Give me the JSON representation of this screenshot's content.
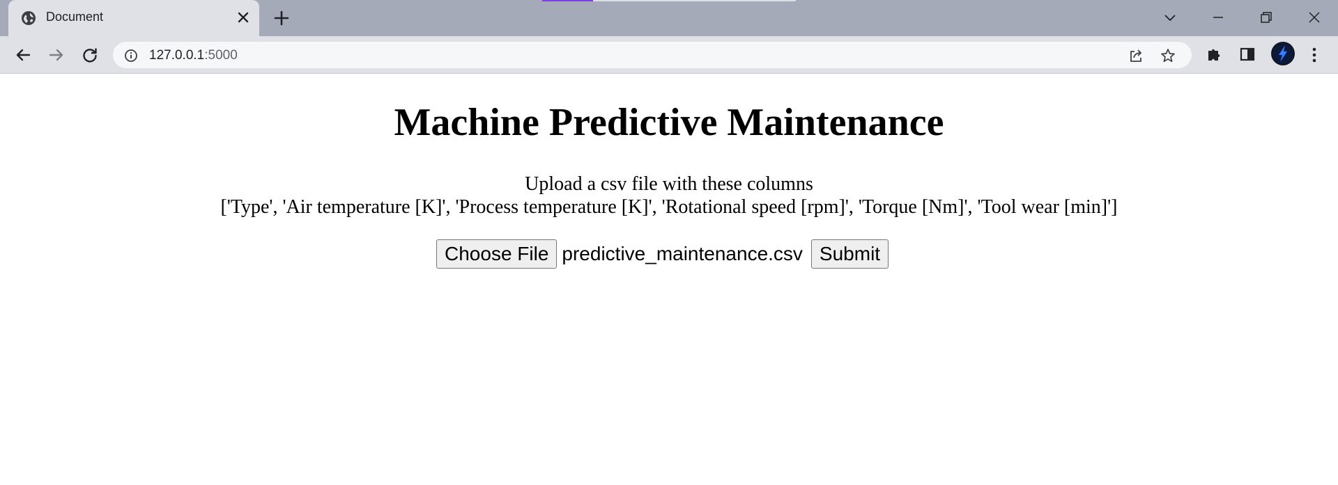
{
  "browser": {
    "tab_title": "Document",
    "url_host": "127.0.0.1",
    "url_port": ":5000"
  },
  "page": {
    "heading": "Machine Predictive Maintenance",
    "instruction_line1": "Upload a csv file with these columns",
    "instruction_line2": "['Type', 'Air temperature [K]', 'Process temperature [K]', 'Rotational speed [rpm]', 'Torque [Nm]', 'Tool wear [min]']",
    "upload": {
      "choose_file_label": "Choose File",
      "selected_file": "predictive_maintenance.csv",
      "submit_label": "Submit"
    }
  }
}
